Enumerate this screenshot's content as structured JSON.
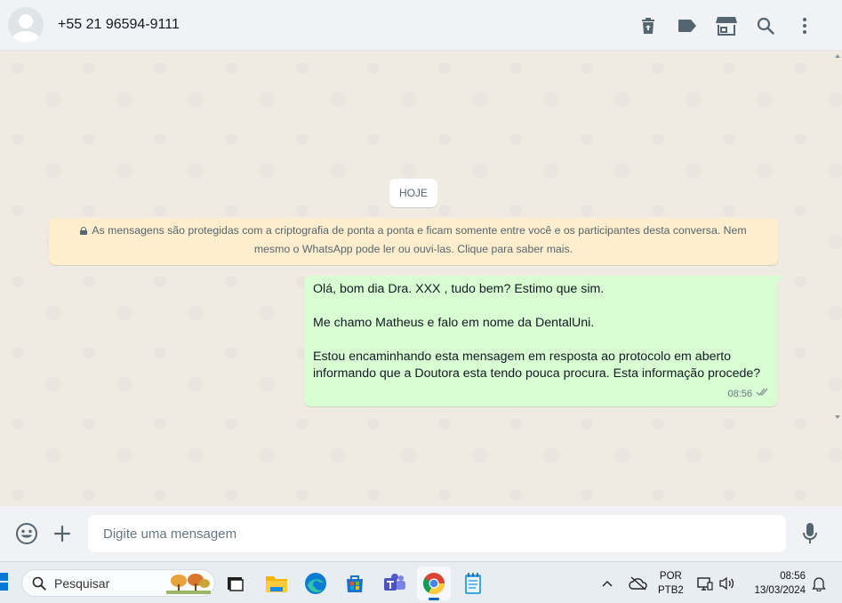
{
  "header": {
    "contact_name": "+55 21 96594-9111",
    "actions": [
      "trash-icon",
      "label-icon",
      "store-icon",
      "search-icon",
      "menu-icon"
    ]
  },
  "chat": {
    "date_label": "HOJE",
    "encryption_notice_line1": "As mensagens são protegidas com a criptografia de ponta a ponta e ficam somente entre você e os participantes desta conversa. Nem",
    "encryption_notice_line2": "mesmo o WhatsApp pode ler ou ouvi-las. Clique para saber mais.",
    "message": {
      "line1": "Olá, bom dia Dra. XXX , tudo bem? Estimo que sim.",
      "line2": "Me chamo Matheus e falo em nome da DentalUni.",
      "line3": "Estou encaminhando esta mensagem em resposta ao protocolo em aberto",
      "line4": "informando que a Doutora esta  tendo pouca procura. Esta informação procede?",
      "time": "08:56",
      "status": "delivered"
    }
  },
  "composer": {
    "placeholder": "Digite uma mensagem"
  },
  "taskbar": {
    "search_label": "Pesquisar",
    "language_line1": "POR",
    "language_line2": "PTB2",
    "time": "08:56",
    "date": "13/03/2024"
  },
  "colors": {
    "outgoing_bubble": "#d9fdd3",
    "encryption_banner": "#ffeecd",
    "chat_background": "#efeae2",
    "header_bg": "#f0f2f5"
  }
}
